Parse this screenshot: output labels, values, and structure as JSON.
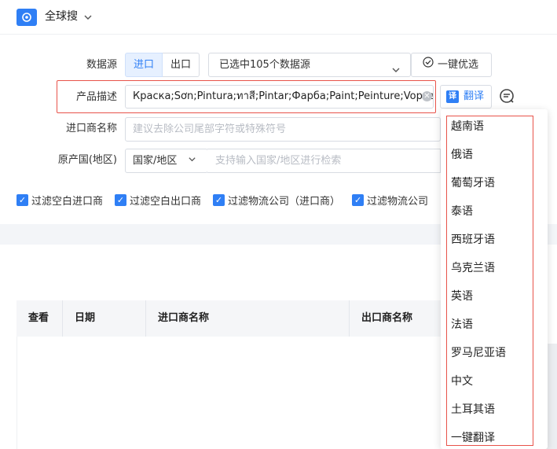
{
  "header": {
    "title": "全球搜"
  },
  "form": {
    "datasource_label": "数据源",
    "import_tab": "进口",
    "export_tab": "出口",
    "datasource_selected": "已选中105个数据源",
    "one_click_optimize": "一键优选",
    "product_desc_label": "产品描述",
    "product_desc_value": "Краска;Sơn;Pintura;ทาสี;Pintar;Фарба;Paint;Peinture;Vopsea",
    "translate_button": "翻译",
    "translate_icon_text": "译",
    "importer_label": "进口商名称",
    "importer_placeholder": "建议去除公司尾部字符或特殊符号",
    "origin_label": "原产国(地区)",
    "origin_type": "国家/地区",
    "origin_placeholder": "支持输入国家/地区进行检索"
  },
  "filters": [
    "过滤空白进口商",
    "过滤空白出口商",
    "过滤物流公司（进口商）",
    "过滤物流公司"
  ],
  "table": {
    "columns": [
      "查看",
      "日期",
      "进口商名称",
      "出口商名称"
    ]
  },
  "language_menu": [
    "越南语",
    "俄语",
    "葡萄牙语",
    "泰语",
    "西班牙语",
    "乌克兰语",
    "英语",
    "法语",
    "罗马尼亚语",
    "中文",
    "土耳其语",
    "一键翻译"
  ],
  "colors": {
    "accent": "#2f7ff5",
    "highlight_red": "#e8534a"
  }
}
